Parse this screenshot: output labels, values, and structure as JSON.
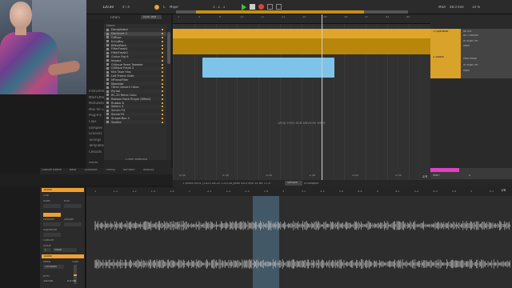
{
  "toolbar": {
    "tempo": "120.00",
    "meter": "4 / 4",
    "position": "1 . 1 . 1",
    "key": "C",
    "scale": "Major",
    "midi_label": "MIDI",
    "cpu": "48.0 kHz",
    "load": "10 %"
  },
  "browser": {
    "search_placeholder": "Filters",
    "auto_tags": "Auto Tags",
    "sidebar": [
      "Instruments",
      "MIDI Effects",
      "Modulators",
      "Max for Live",
      "Plug-Ins",
      "Clips",
      "Samples",
      "Grooves",
      "Tunings",
      "Templates",
      "Chkouts"
    ],
    "places_label": "Places",
    "packs_label": "Packs",
    "name_header": "Name",
    "items": [
      "Decapitator",
      "Decimort 2",
      "Diffuse",
      "EchoBoy",
      "EffectRack",
      "FilterFreak1",
      "FilterFreak2",
      "Guitar Rig 6",
      "Impact",
      "Glitique Reed Tweaker",
      "Glitique Freak 2",
      "Kits Tape Hiss",
      "Lofi Frame Gate",
      "MFreakFilter",
      "Modalite",
      "Other Desert Cities",
      "Pyrnal",
      "RC-20 Retro Color",
      "Reason Rack Plugin (Effect)",
      "Rubber-K",
      "Saturn 2",
      "Serum FX",
      "ServerFX",
      "ShaperBox 3",
      "Soothe"
    ],
    "selected_count": "1 item selected"
  },
  "groove": {
    "headers": [
      "Groove Name",
      "Base",
      "Quantize",
      "Timing",
      "Random",
      "Velocity"
    ],
    "global_amount_label": "Global Amount",
    "global_amount": "100%"
  },
  "arrangement": {
    "ruler_marks": [
      "1",
      "5",
      "9",
      "13",
      "17",
      "21",
      "25",
      "29",
      "33",
      "37",
      "41",
      "45"
    ],
    "time_marks": [
      "0:00",
      "0:30",
      "1:00",
      "1:30",
      "2:00",
      "2:30"
    ],
    "drop_text": "Drop Files and Devices Here",
    "track1_name": "1 Operator",
    "track1_input": "All Ins",
    "track1_channel": "All Channel",
    "track1_monitor": "In Auto Off",
    "track1_output": "Main",
    "track2_name": "2 Audio",
    "track2_input": "Post Mixer",
    "track2_monitor": "In Auto Off",
    "track2_output": "Main",
    "master_name": "Main",
    "master_value": "0",
    "zoom_label": "2/4"
  },
  "clip": {
    "title": "Audio",
    "clip_label": "Clip",
    "start_label": "Start",
    "end_label": "End",
    "position_label": "Position",
    "length_label": "Length",
    "signature_label": "Signature",
    "groove_label": "Groove",
    "scale_label": "Scale",
    "scale_value": "Major",
    "key_value": "C",
    "audio_label": "Audio",
    "warp_label": "Warp",
    "mode_label": "Complex",
    "bpm_label": "BPM",
    "bpm_value": "120.00",
    "gain_label": "Gain",
    "gain_value": "0.0 dB",
    "sample_info": "1 Audio 0001 [2025-08-20 133128].wav  48.0 kHz  24 Bit  2 Ch",
    "tab_sample": "Sample",
    "tab_envelopes": "Envelopes",
    "sample_ruler": [
      "1",
      "1.1",
      "1.2",
      "1.3",
      "1.4",
      "2",
      "2.1",
      "2.2",
      "2.3",
      "2.4",
      "3",
      "3.1",
      "3.2",
      "3.3",
      "3.4",
      "4",
      "4.1",
      "4.2",
      "4.3",
      "4.4",
      "5",
      "5.1"
    ],
    "zoom_value": "1/8"
  },
  "colors": {
    "track_orange": "#e0a52a",
    "clip_blue": "#7ec4e8",
    "master_magenta": "#e040c0",
    "accent": "#f0a030"
  }
}
